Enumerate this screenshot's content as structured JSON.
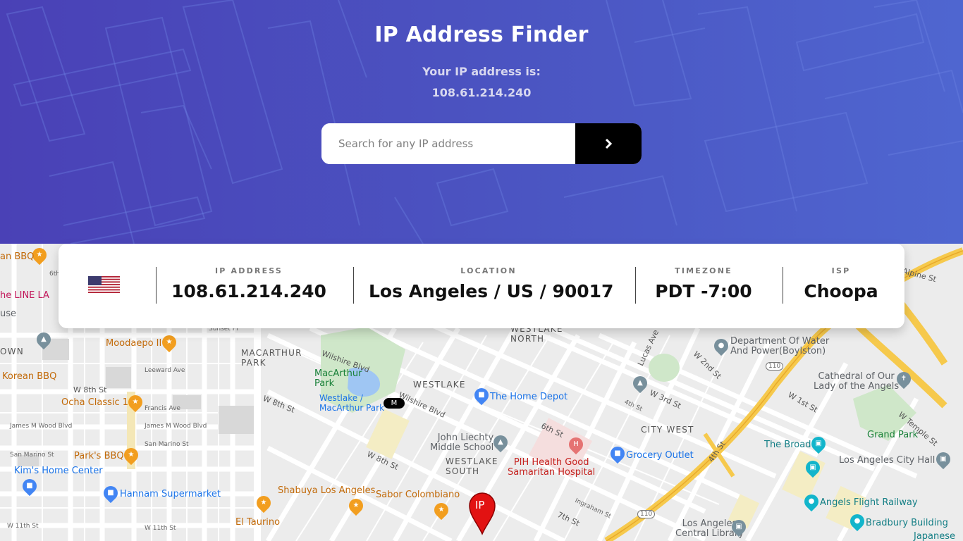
{
  "header": {
    "title": "IP Address Finder",
    "subtitle": "Your IP address is:",
    "current_ip": "108.61.214.240"
  },
  "search": {
    "placeholder": "Search for any IP address",
    "value": "",
    "button_icon": "chevron-right-icon"
  },
  "info": {
    "flag_icon": "us-flag-icon",
    "ip_label": "IP ADDRESS",
    "ip_value": "108.61.214.240",
    "location_label": "LOCATION",
    "location_value": "Los Angeles / US / 90017",
    "timezone_label": "TIMEZONE",
    "timezone_value": "PDT -7:00",
    "isp_label": "ISP",
    "isp_value": "Choopa"
  },
  "map": {
    "marker_text": "IP",
    "districts": {
      "macarthur": "MACARTHUR\nPARK",
      "westlake_north": "WESTLAKE\nNORTH",
      "westlake": "WESTLAKE",
      "westlake_south": "WESTLAKE\nSOUTH",
      "city_west": "CITY WEST",
      "town": "OWN"
    },
    "places": {
      "bbq": "an BBQ",
      "line_la": "he LINE LA",
      "use": "use",
      "moodaepo": "Moodaepo II",
      "korean_bbq": "Korean BBQ",
      "ocha": "Ocha Classic 1",
      "parks_bbq": "Park's BBQ",
      "kims": "Kim's Home Center",
      "hannam": "Hannam Supermarket",
      "shabuya": "Shabuya Los Angeles",
      "sabor": "Sabor Colombiano",
      "el_taurino": "El Taurino",
      "macarthur_park": "MacArthur\nPark",
      "westlake_station": "Westlake /\nMacArthur Park",
      "home_depot": "The Home Depot",
      "john_liechty": "John Liechty\nMiddle School",
      "pih": "PIH Health Good\nSamaritan Hospital",
      "grocery_outlet": "Grocery Outlet",
      "dwp": "Department Of Water\nAnd Power(Boylston)",
      "cathedral": "Cathedral of Our\nLady of the Angels",
      "grand_park": "Grand Park",
      "the_broad": "The Broad",
      "la_city_hall": "Los Angeles City Hall",
      "angels_flight": "Angels Flight Railway",
      "bradbury": "Bradbury Building",
      "la_central_library": "Los Angeles\nCentral Library",
      "japanese": "Japanese"
    },
    "streets": {
      "sixth_a": "6th",
      "sunset_pl": "Sunset Pl",
      "leeward": "Leeward Ave",
      "w8th": "W 8th St",
      "francis": "Francis Ave",
      "james_wood": "James M Wood Blvd",
      "james_wood2": "James M Wood Blvd",
      "san_marino": "San Marino St",
      "san_marino2": "San Marino St",
      "w11th": "W 11th St",
      "w11th2": "W 11th St",
      "wilshire": "Wilshire Blvd",
      "wilshire2": "Wilshire Blvd",
      "w8th2": "W 8th St",
      "w8th3": "W 8th St",
      "sixth_b": "6th St",
      "w3rd": "W 3rd St",
      "w2nd": "W 2nd St",
      "w1st": "W 1st St",
      "w_temple": "W Temple St",
      "fourth": "4th St",
      "fourth_b": "4th St",
      "seventh": "7th St",
      "ingraham": "Ingraham St",
      "lucas": "Lucas Ave",
      "alpine": "Alpine St",
      "hwy110": "110",
      "hwy110b": "110"
    }
  },
  "colors": {
    "hero_start": "#4a41b6",
    "hero_end": "#4f66d0",
    "button": "#000000",
    "marker": "#e21212"
  }
}
